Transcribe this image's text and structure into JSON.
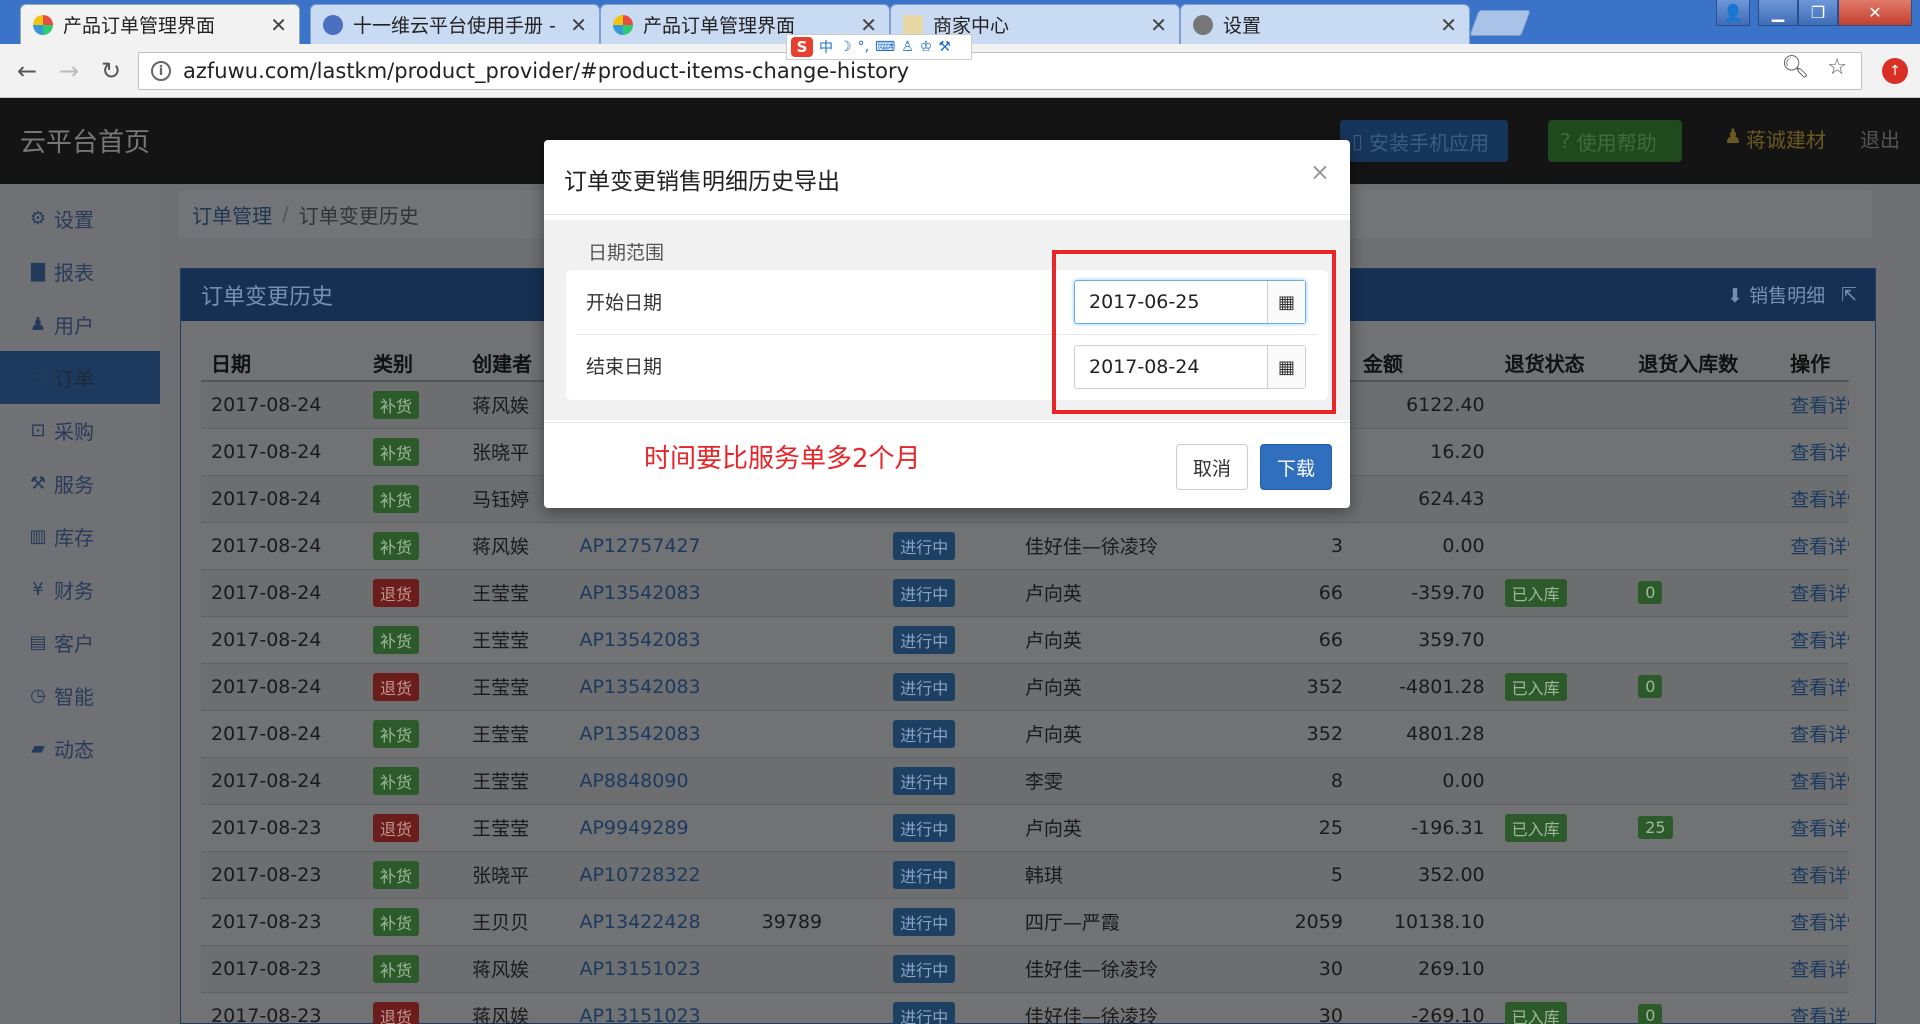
{
  "browser": {
    "tabs": [
      {
        "title": "产品订单管理界面",
        "active": true
      },
      {
        "title": "十一维云平台使用手册 -"
      },
      {
        "title": "产品订单管理界面"
      },
      {
        "title": "商家中心"
      },
      {
        "title": "设置"
      }
    ],
    "url": "azfuwu.com/lastkm/product_provider/#product-items-change-history",
    "ime": {
      "mode": "中"
    }
  },
  "header": {
    "brand": "云平台首页",
    "install_app": "安装手机应用",
    "help": "使用帮助",
    "user": "蒋诚建材",
    "logout": "退出"
  },
  "sidebar": {
    "items": [
      {
        "label": "设置",
        "icon": "gear-icon"
      },
      {
        "label": "报表",
        "icon": "bar-chart-icon"
      },
      {
        "label": "用户",
        "icon": "user-icon"
      },
      {
        "label": "订单",
        "icon": "list-icon",
        "active": true
      },
      {
        "label": "采购",
        "icon": "cart-icon"
      },
      {
        "label": "服务",
        "icon": "wrench-icon"
      },
      {
        "label": "库存",
        "icon": "barcode-icon"
      },
      {
        "label": "财务",
        "icon": "yen-icon"
      },
      {
        "label": "客户",
        "icon": "briefcase-icon"
      },
      {
        "label": "智能",
        "icon": "clock-icon"
      },
      {
        "label": "动态",
        "icon": "comment-icon"
      }
    ]
  },
  "breadcrumb": {
    "root": "订单管理",
    "current": "订单变更历史"
  },
  "panel": {
    "title": "订单变更历史",
    "sales_detail": "销售明细"
  },
  "table": {
    "headers": [
      "日期",
      "类别",
      "创建者",
      "",
      "",
      "",
      "",
      "",
      "金额",
      "退货状态",
      "退货入库数",
      "操作"
    ],
    "rows": [
      {
        "date": "2017-08-24",
        "type": "补货",
        "creator": "蒋风娭",
        "order": "",
        "ref": "",
        "status": "",
        "customer": "",
        "qty": "",
        "amount": "6122.40",
        "ret_status": "",
        "ret_qty": "",
        "action": "查看详情"
      },
      {
        "date": "2017-08-24",
        "type": "补货",
        "creator": "张晓平",
        "order": "",
        "ref": "",
        "status": "",
        "customer": "",
        "qty": "",
        "amount": "16.20",
        "ret_status": "",
        "ret_qty": "",
        "action": "查看详情"
      },
      {
        "date": "2017-08-24",
        "type": "补货",
        "creator": "马钰婷",
        "order": "",
        "ref": "",
        "status": "",
        "customer": "",
        "qty": "",
        "amount": "624.43",
        "ret_status": "",
        "ret_qty": "",
        "action": "查看详情"
      },
      {
        "date": "2017-08-24",
        "type": "补货",
        "creator": "蒋风娭",
        "order": "AP12757427",
        "ref": "",
        "status": "进行中",
        "customer": "佳好佳—徐凌玲",
        "qty": "3",
        "amount": "0.00",
        "ret_status": "",
        "ret_qty": "",
        "action": "查看详情"
      },
      {
        "date": "2017-08-24",
        "type": "退货",
        "creator": "王莹莹",
        "order": "AP13542083",
        "ref": "",
        "status": "进行中",
        "customer": "卢向英",
        "qty": "66",
        "amount": "-359.70",
        "ret_status": "已入库",
        "ret_qty": "0",
        "action": "查看详情"
      },
      {
        "date": "2017-08-24",
        "type": "补货",
        "creator": "王莹莹",
        "order": "AP13542083",
        "ref": "",
        "status": "进行中",
        "customer": "卢向英",
        "qty": "66",
        "amount": "359.70",
        "ret_status": "",
        "ret_qty": "",
        "action": "查看详情"
      },
      {
        "date": "2017-08-24",
        "type": "退货",
        "creator": "王莹莹",
        "order": "AP13542083",
        "ref": "",
        "status": "进行中",
        "customer": "卢向英",
        "qty": "352",
        "amount": "-4801.28",
        "ret_status": "已入库",
        "ret_qty": "0",
        "action": "查看详情"
      },
      {
        "date": "2017-08-24",
        "type": "补货",
        "creator": "王莹莹",
        "order": "AP13542083",
        "ref": "",
        "status": "进行中",
        "customer": "卢向英",
        "qty": "352",
        "amount": "4801.28",
        "ret_status": "",
        "ret_qty": "",
        "action": "查看详情"
      },
      {
        "date": "2017-08-24",
        "type": "补货",
        "creator": "王莹莹",
        "order": "AP8848090",
        "ref": "",
        "status": "进行中",
        "customer": "李雯",
        "qty": "8",
        "amount": "0.00",
        "ret_status": "",
        "ret_qty": "",
        "action": "查看详情"
      },
      {
        "date": "2017-08-23",
        "type": "退货",
        "creator": "王莹莹",
        "order": "AP9949289",
        "ref": "",
        "status": "进行中",
        "customer": "卢向英",
        "qty": "25",
        "amount": "-196.31",
        "ret_status": "已入库",
        "ret_qty": "25",
        "action": "查看详情"
      },
      {
        "date": "2017-08-23",
        "type": "补货",
        "creator": "张晓平",
        "order": "AP10728322",
        "ref": "",
        "status": "进行中",
        "customer": "韩琪",
        "qty": "5",
        "amount": "352.00",
        "ret_status": "",
        "ret_qty": "",
        "action": "查看详情"
      },
      {
        "date": "2017-08-23",
        "type": "补货",
        "creator": "王贝贝",
        "order": "AP13422428",
        "ref": "39789",
        "status": "进行中",
        "customer": "四厅—严霞",
        "qty": "2059",
        "amount": "10138.10",
        "ret_status": "",
        "ret_qty": "",
        "action": "查看详情"
      },
      {
        "date": "2017-08-23",
        "type": "补货",
        "creator": "蒋风娭",
        "order": "AP13151023",
        "ref": "",
        "status": "进行中",
        "customer": "佳好佳—徐凌玲",
        "qty": "30",
        "amount": "269.10",
        "ret_status": "",
        "ret_qty": "",
        "action": "查看详情"
      },
      {
        "date": "2017-08-23",
        "type": "退货",
        "creator": "蒋风娭",
        "order": "AP13151023",
        "ref": "",
        "status": "进行中",
        "customer": "佳好佳—徐凌玲",
        "qty": "30",
        "amount": "-269.10",
        "ret_status": "已入库",
        "ret_qty": "0",
        "action": "查看详情"
      }
    ]
  },
  "modal": {
    "title": "订单变更销售明细历史导出",
    "close": "×",
    "range_label": "日期范围",
    "start_label": "开始日期",
    "start_value": "2017-06-25",
    "end_label": "结束日期",
    "end_value": "2017-08-24",
    "note": "时间要比服务单多2个月",
    "cancel": "取消",
    "download": "下载"
  },
  "colors": {
    "accent_blue": "#2f6fbe",
    "annotation_red": "#e8262a",
    "header_bg": "#141414"
  }
}
